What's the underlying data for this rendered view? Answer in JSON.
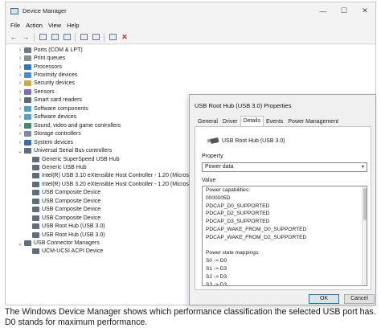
{
  "window": {
    "title": "Device Manager",
    "controls": {
      "minimize": "—",
      "maximize": "☐",
      "close": "✕"
    }
  },
  "menu": [
    "File",
    "Action",
    "View",
    "Help"
  ],
  "toolbar": {
    "buttons": [
      "back-arrow-icon",
      "forward-arrow-icon",
      "properties-icon",
      "help-icon",
      "scan-icon",
      "update-driver-icon",
      "enable-icon",
      "uninstall-icon"
    ],
    "back_glyph": "←",
    "forward_glyph": "→",
    "remove_glyph": "✕",
    "remove_color": "#c42b1c"
  },
  "tree": [
    {
      "level": 1,
      "expander": "›",
      "icon": "port",
      "label": "Ports (COM & LPT)"
    },
    {
      "level": 1,
      "expander": "›",
      "icon": "print",
      "label": "Print queues"
    },
    {
      "level": 1,
      "expander": "›",
      "icon": "cpu",
      "label": "Processors"
    },
    {
      "level": 1,
      "expander": "›",
      "icon": "prox",
      "label": "Proximity devices"
    },
    {
      "level": 1,
      "expander": "›",
      "icon": "sec",
      "label": "Security devices"
    },
    {
      "level": 1,
      "expander": "›",
      "icon": "sens",
      "label": "Sensors"
    },
    {
      "level": 1,
      "expander": "›",
      "icon": "card",
      "label": "Smart card readers"
    },
    {
      "level": 1,
      "expander": "›",
      "icon": "sw",
      "label": "Software components"
    },
    {
      "level": 1,
      "expander": "›",
      "icon": "sw",
      "label": "Software devices"
    },
    {
      "level": 1,
      "expander": "›",
      "icon": "snd",
      "label": "Sound, video and game controllers"
    },
    {
      "level": 1,
      "expander": "›",
      "icon": "stor",
      "label": "Storage controllers"
    },
    {
      "level": 1,
      "expander": "›",
      "icon": "sys",
      "label": "System devices"
    },
    {
      "level": 1,
      "expander": "⌄",
      "icon": "usb",
      "label": "Universal Serial Bus controllers"
    },
    {
      "level": 2,
      "expander": "",
      "icon": "usb",
      "label": "Generic SuperSpeed USB Hub"
    },
    {
      "level": 2,
      "expander": "",
      "icon": "usb",
      "label": "Generic USB Hub"
    },
    {
      "level": 2,
      "expander": "",
      "icon": "usb",
      "label": "Intel(R) USB 3.10 eXtensible Host Controller - 1.20 (Microsoft)"
    },
    {
      "level": 2,
      "expander": "",
      "icon": "usb",
      "label": "Intel(R) USB 3.20 eXtensible Host Controller - 1.20 (Microsoft)"
    },
    {
      "level": 2,
      "expander": "",
      "icon": "usb",
      "label": "USB Composite Device"
    },
    {
      "level": 2,
      "expander": "",
      "icon": "usb",
      "label": "USB Composite Device"
    },
    {
      "level": 2,
      "expander": "",
      "icon": "usb",
      "label": "USB Composite Device"
    },
    {
      "level": 2,
      "expander": "",
      "icon": "usb",
      "label": "USB Composite Device"
    },
    {
      "level": 2,
      "expander": "",
      "icon": "usb",
      "label": "USB Root Hub (USB 3.0)"
    },
    {
      "level": 2,
      "expander": "",
      "icon": "usb",
      "label": "USB Root Hub (USB 3.0)"
    },
    {
      "level": 1,
      "expander": "⌄",
      "icon": "usb",
      "label": "USB Connector Managers"
    },
    {
      "level": 2,
      "expander": "",
      "icon": "usb",
      "label": "UCM-UCSI ACPI Device"
    }
  ],
  "dialog": {
    "title": "USB Root Hub (USB 3.0) Properties",
    "tabs": [
      "General",
      "Driver",
      "Details",
      "Events",
      "Power Management"
    ],
    "active_tab": "Details",
    "device_name": "USB Root Hub (USB 3.0)",
    "property_label": "Property",
    "property_value": "Power data",
    "dropdown_glyph": "▾",
    "value_label": "Value",
    "values": [
      "Power capabilities:",
      "0000005D",
      "PDCAP_D0_SUPPORTED",
      "PDCAP_D2_SUPPORTED",
      "PDCAP_D3_SUPPORTED",
      "PDCAP_WAKE_FROM_D0_SUPPORTED",
      "PDCAP_WAKE_FROM_D2_SUPPORTED",
      "",
      "Power state mappings:",
      "S0 -> D0",
      "S1 -> D3",
      "S2 -> D3",
      "S3 -> D3"
    ],
    "ok_label": "OK",
    "cancel_label": "Cancel"
  },
  "caption": "The Windows Device Manager shows which performance classification the selected USB port has. D0 stands for maximum performance."
}
